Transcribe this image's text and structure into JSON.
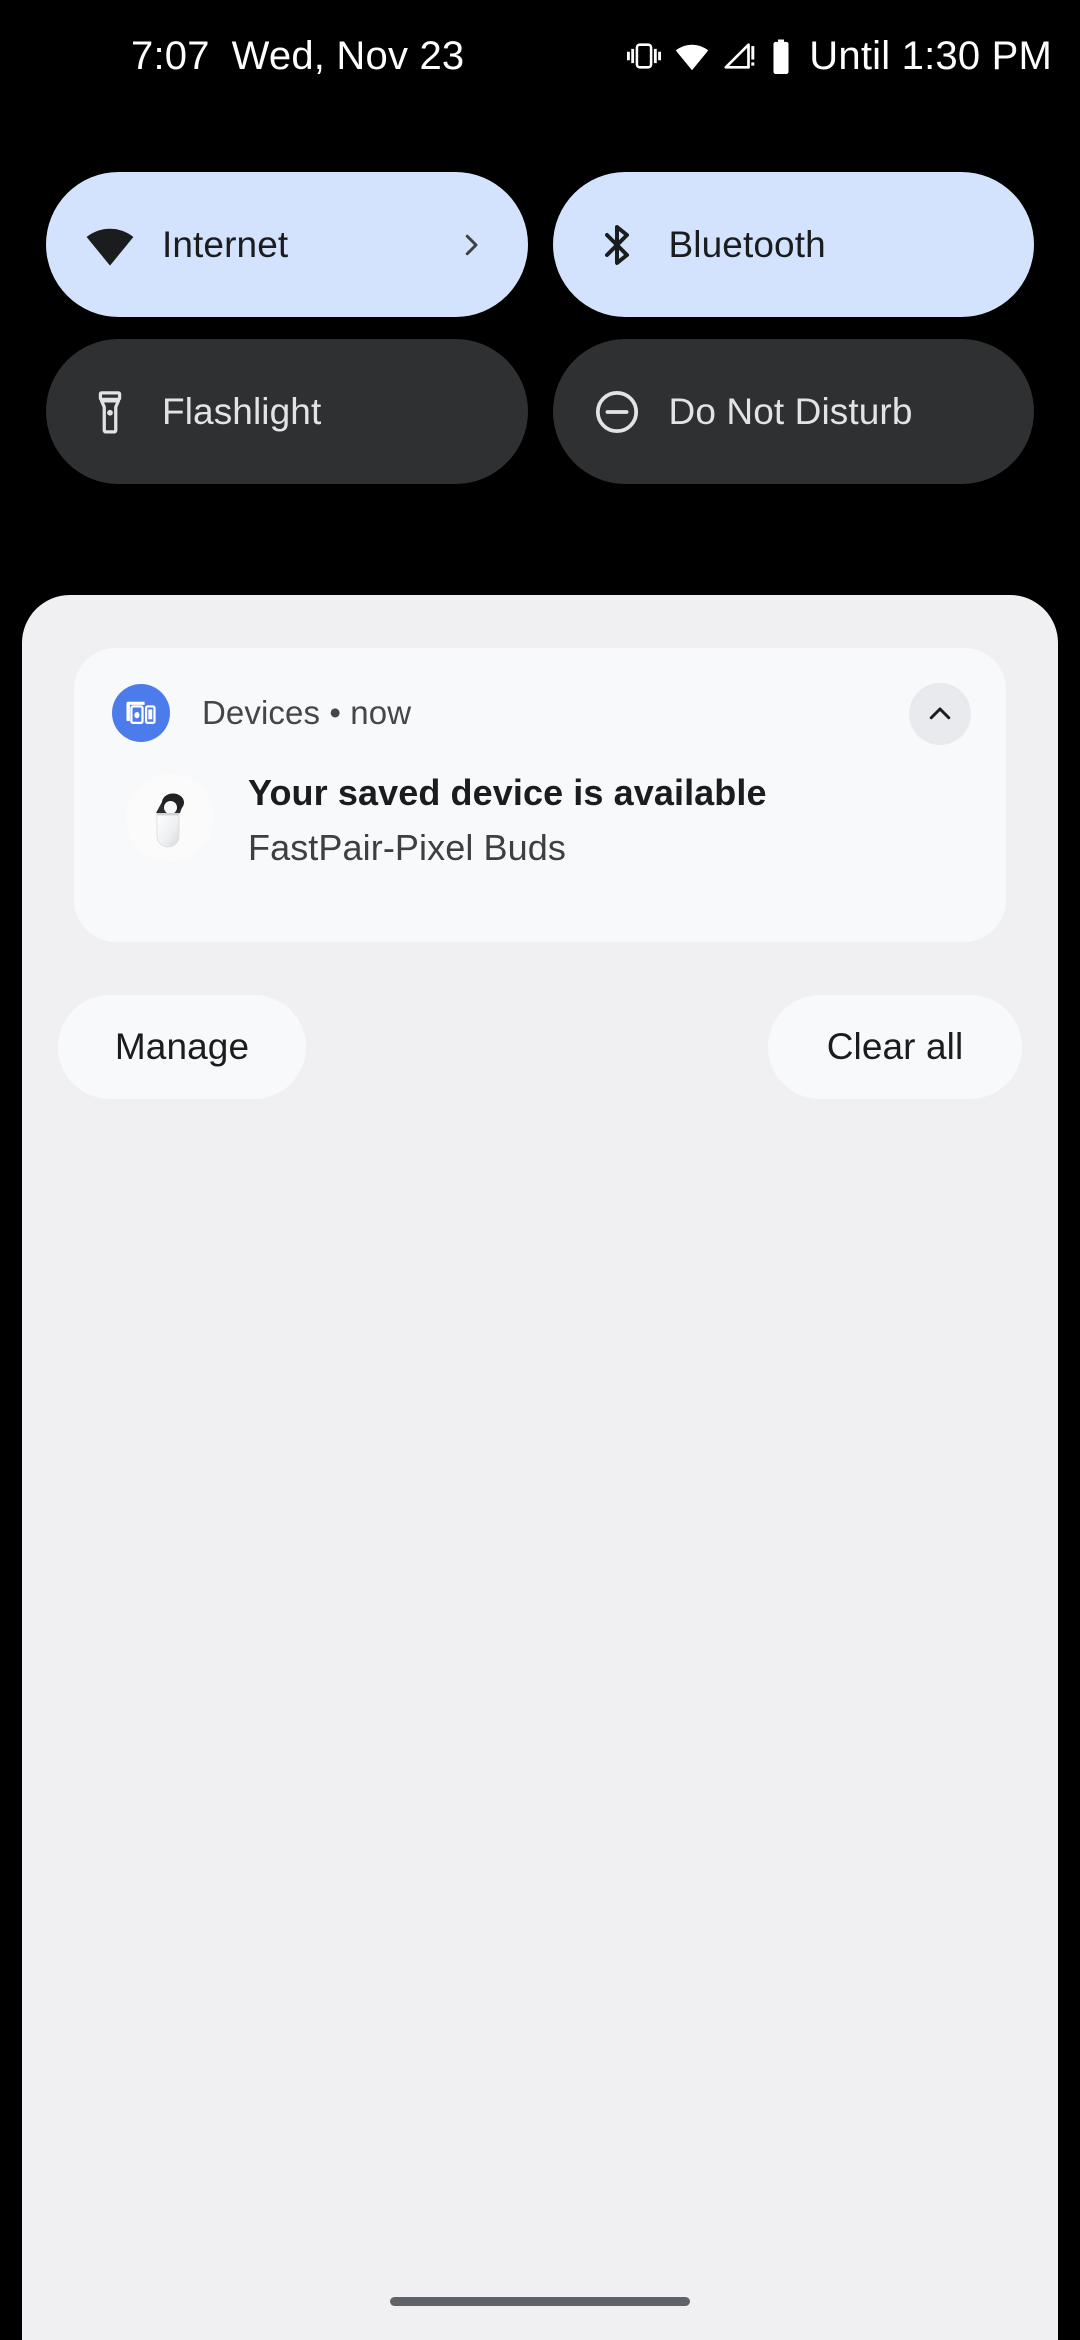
{
  "status_bar": {
    "clock": "7:07",
    "date": "Wed, Nov 23",
    "icons": [
      "vibrate-icon",
      "wifi-icon",
      "mobile-signal-no-sim-icon",
      "battery-icon"
    ],
    "battery_status": "Until 1:30 PM"
  },
  "quick_settings": {
    "tiles": [
      {
        "label": "Internet",
        "icon": "wifi-icon",
        "state": "on",
        "has_chevron": true
      },
      {
        "label": "Bluetooth",
        "icon": "bluetooth-icon",
        "state": "on",
        "has_chevron": false
      },
      {
        "label": "Flashlight",
        "icon": "flashlight-icon",
        "state": "off",
        "has_chevron": false
      },
      {
        "label": "Do Not Disturb",
        "icon": "dnd-icon",
        "state": "off",
        "has_chevron": false
      }
    ]
  },
  "notification": {
    "app_name": "Devices",
    "separator": "•",
    "time": "now",
    "app_icon": "devices-cast-icon",
    "expand_icon": "chevron-up-icon",
    "thumbnail": "pixel-buds-case-image",
    "title": "Your saved device is available",
    "subtitle": "FastPair-Pixel Buds"
  },
  "shade_actions": {
    "manage_label": "Manage",
    "clear_all_label": "Clear all"
  },
  "colors": {
    "background": "#000000",
    "tile_on": "#d3e3fd",
    "tile_off": "#2e3032",
    "shade": "#f0f0f2",
    "notification_card": "#f8f9fb",
    "app_icon_blue": "#4c7ceb"
  }
}
